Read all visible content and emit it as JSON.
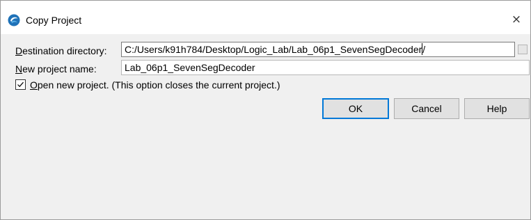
{
  "dialog": {
    "title": "Copy Project",
    "close_label": "×"
  },
  "destination": {
    "label_accel": "D",
    "label_rest": "estination directory:",
    "value": "C:/Users/k91h784/Desktop/Logic_Lab/Lab_06p1_SevenSegDecoder",
    "value_tail": "/"
  },
  "project_name": {
    "label_accel": "N",
    "label_rest": "ew project name:",
    "value": "Lab_06p1_SevenSegDecoder"
  },
  "open_project": {
    "checked": true,
    "label_accel": "O",
    "label_rest": "pen new project. (This option closes the current project.)"
  },
  "buttons": {
    "ok": "OK",
    "cancel": "Cancel",
    "help": "Help"
  },
  "colors": {
    "icon_blue": "#1f72b8",
    "icon_light": "#5ab0e8",
    "default_button_border": "#0078d7"
  }
}
